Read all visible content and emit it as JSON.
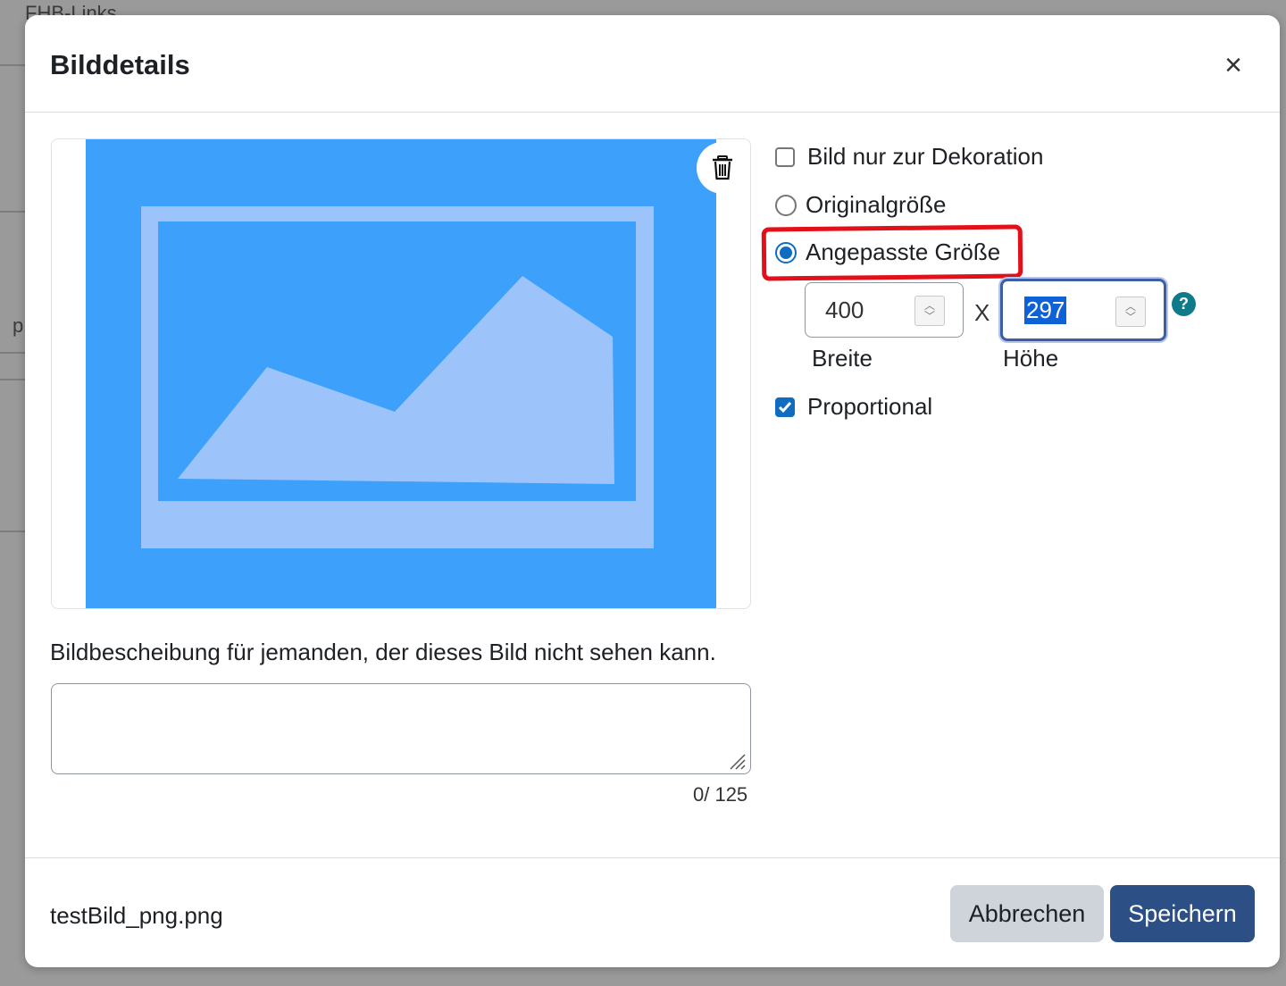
{
  "background": {
    "text_top": "FHB-Links",
    "text_side": "p"
  },
  "dialog": {
    "title": "Bilddetails",
    "close_symbol": "×"
  },
  "options": {
    "decorative_label": "Bild nur zur Dekoration",
    "decorative_checked": false,
    "original_size_label": "Originalgröße",
    "custom_size_label": "Angepasste Größe",
    "selected_size": "custom",
    "width_value": "400",
    "width_label": "Breite",
    "separator": "X",
    "height_value": "297",
    "height_label": "Höhe",
    "help_symbol": "?",
    "proportional_label": "Proportional",
    "proportional_checked": true
  },
  "description": {
    "label": "Bildbescheibung für jemanden, der dieses Bild nicht sehen kann.",
    "value": "",
    "char_count": "0/ 125"
  },
  "footer": {
    "file_name": "testBild_png.png",
    "cancel_label": "Abbrechen",
    "save_label": "Speichern"
  },
  "colors": {
    "accent": "#0f6cbf",
    "save_button": "#2c4f86",
    "cancel_button": "#ced4da",
    "highlight": "#e3101a",
    "preview_blue": "#3da0fb",
    "preview_light": "#9cc4fb",
    "help_icon": "#0f7a8a"
  },
  "icons": {
    "close": "close-icon",
    "delete": "trash-icon",
    "help": "question-icon",
    "placeholder": "image-placeholder-icon"
  }
}
